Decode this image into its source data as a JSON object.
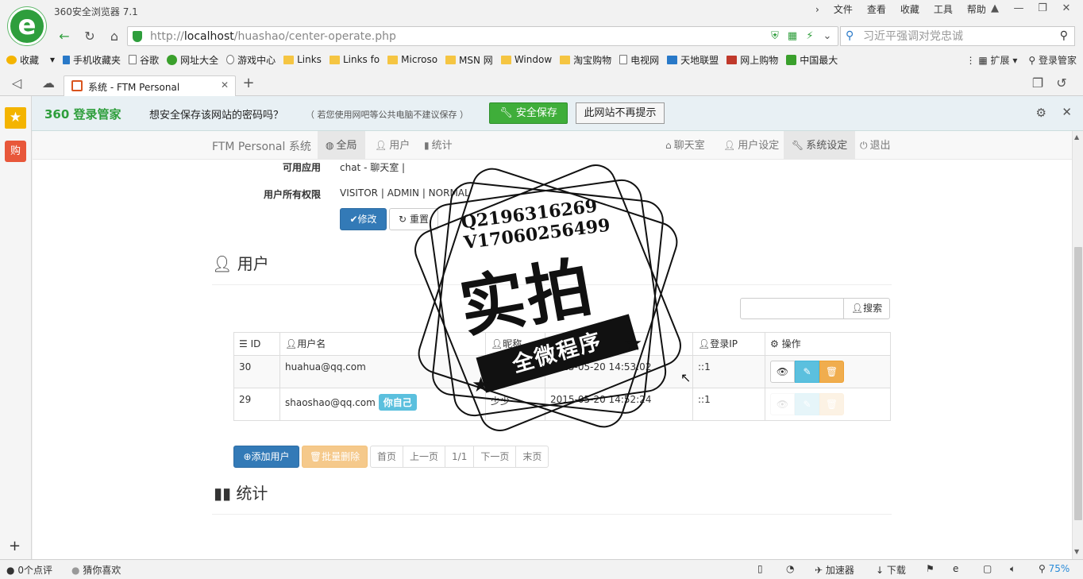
{
  "browser": {
    "app_title": "360安全浏览器 7.1",
    "menu": [
      "文件",
      "查看",
      "收藏",
      "工具",
      "帮助"
    ],
    "url_host": "localhost",
    "url_prefix": "http://",
    "url_path": "/huashao/center-operate.php",
    "search_text": "习近平强调对党忠诚",
    "bookmarks": [
      "收藏",
      "手机收藏夹",
      "谷歌",
      "网址大全",
      "游戏中心",
      "Links",
      "Links fo",
      "Microso",
      "MSN 网",
      "Window",
      "淘宝购物",
      "电视网",
      "天地联盟",
      "网上购物",
      "中国最大"
    ],
    "bookmark_right": [
      "扩展",
      "登录管家"
    ],
    "tab_title": "系统 - FTM Personal",
    "new_tab": "+"
  },
  "pwbar": {
    "brand": "360 登录管家",
    "question": "想安全保存该网站的密码吗？",
    "note": "（ 若您使用网吧等公共电脑不建议保存 ）",
    "save": "安全保存",
    "never": "此网站不再提示"
  },
  "sidebar": {
    "shop": "购"
  },
  "nav": {
    "brand": "FTM Personal 系统",
    "left": [
      "全局",
      "用户",
      "统计"
    ],
    "right": [
      "聊天室",
      "用户设定",
      "系统设定",
      "退出"
    ],
    "active_left": "全局",
    "active_right": "系统设定"
  },
  "form": {
    "apps_label": "可用应用",
    "apps_value": "chat - 聊天室 |",
    "perm_label": "用户所有权限",
    "perm_value": "VISITOR | ADMIN | NORMAL",
    "modify": "修改",
    "reset": "重置"
  },
  "users": {
    "heading": "用户",
    "search_btn": "搜索",
    "columns": [
      "ID",
      "用户名",
      "昵称",
      "创建时间",
      "登录IP",
      "操作"
    ],
    "rows": [
      {
        "id": "30",
        "username": "huahua@qq.com",
        "nickname": "",
        "created": "2015-05-20 14:53:02",
        "ip": "::1",
        "self": ""
      },
      {
        "id": "29",
        "username": "shaoshao@qq.com",
        "nickname": "少少",
        "created": "2015-05-20 14:52:24",
        "ip": "::1",
        "self": "你自己"
      }
    ],
    "add_user": "添加用户",
    "batch_delete": "批量删除",
    "pager": [
      "首页",
      "上一页",
      "1/1",
      "下一页",
      "末页"
    ]
  },
  "stats": {
    "heading": "统计"
  },
  "watermark": {
    "line1": "Q2196316269",
    "line2": "V17060256499",
    "big": "实拍",
    "ribbon": "全微程序"
  },
  "statusbar": {
    "comments": "0个点评",
    "guess": "猜你喜欢",
    "accelerator": "加速器",
    "download": "下载",
    "zoom": "75%"
  }
}
